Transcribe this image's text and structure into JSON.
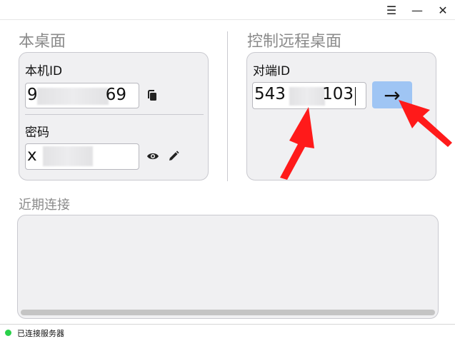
{
  "titlebar": {
    "menu_glyph": "☰",
    "minimize_glyph": "—",
    "close_glyph": "✕"
  },
  "local": {
    "title": "本桌面",
    "id_label": "本机ID",
    "id_value_start": "9",
    "id_value_end": "69",
    "password_label": "密码",
    "password_value_start": "x",
    "copy_icon": "copy-icon",
    "show_icon": "eye-icon",
    "edit_icon": "pencil-icon"
  },
  "remote": {
    "title": "控制远程桌面",
    "peer_label": "对端ID",
    "peer_value_start": "543",
    "peer_value_end": "103",
    "connect_glyph": "→"
  },
  "recent": {
    "title": "近期连接"
  },
  "status": {
    "text": "已连接服务器",
    "dot_color": "#2ad14a"
  },
  "colors": {
    "accent": "#9fc5f4",
    "annotation": "#ff1a1a"
  }
}
